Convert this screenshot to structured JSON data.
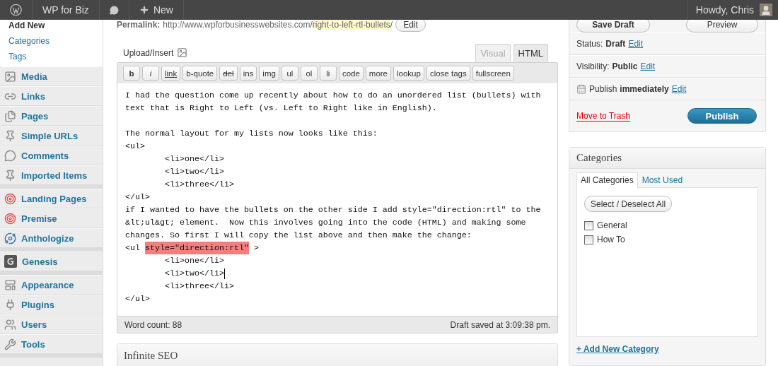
{
  "admin_bar": {
    "site_name": "WP for Biz",
    "new_label": "New",
    "greeting": "Howdy, Chris"
  },
  "sidebar": {
    "submenu": [
      {
        "label": "Add New",
        "current": true
      },
      {
        "label": "Categories",
        "current": false
      },
      {
        "label": "Tags",
        "current": false
      }
    ],
    "groups": [
      [
        {
          "label": "Media"
        },
        {
          "label": "Links"
        },
        {
          "label": "Pages"
        },
        {
          "label": "Simple URLs"
        },
        {
          "label": "Comments"
        },
        {
          "label": "Imported Items"
        }
      ],
      [
        {
          "label": "Landing Pages"
        },
        {
          "label": "Premise"
        },
        {
          "label": "Anthologize"
        }
      ],
      [
        {
          "label": "Genesis"
        }
      ],
      [
        {
          "label": "Appearance"
        },
        {
          "label": "Plugins"
        },
        {
          "label": "Users"
        },
        {
          "label": "Tools"
        }
      ]
    ]
  },
  "permalink": {
    "label": "Permalink:",
    "base": "http://www.wpforbusinesswebsites.com/",
    "slug": "right-to-left-rtl-bullets",
    "trailing": "/",
    "edit_button": "Edit"
  },
  "upload_insert": "Upload/Insert",
  "editor_tabs": [
    {
      "label": "Visual",
      "selected": false
    },
    {
      "label": "HTML",
      "selected": true
    }
  ],
  "quicktags": [
    {
      "label": "b",
      "kind": "bold"
    },
    {
      "label": "i",
      "kind": "italic"
    },
    {
      "label": "link",
      "kind": "underline"
    },
    {
      "label": "b-quote",
      "kind": "plain"
    },
    {
      "label": "del",
      "kind": "strike"
    },
    {
      "label": "ins",
      "kind": "plain"
    },
    {
      "label": "img",
      "kind": "plain"
    },
    {
      "label": "ul",
      "kind": "plain"
    },
    {
      "label": "ol",
      "kind": "plain"
    },
    {
      "label": "li",
      "kind": "plain"
    },
    {
      "label": "code",
      "kind": "plain"
    },
    {
      "label": "more",
      "kind": "plain"
    },
    {
      "label": "lookup",
      "kind": "plain"
    },
    {
      "label": "close tags",
      "kind": "plain"
    },
    {
      "label": "fullscreen",
      "kind": "plain"
    }
  ],
  "editor_lines": [
    {
      "kind": "text",
      "indented": false,
      "caret": false,
      "segments": [
        {
          "text": "I had the question come up recently about how to do an unordered list (bullets) with",
          "highlighted": false
        }
      ]
    },
    {
      "kind": "text",
      "indented": false,
      "caret": false,
      "segments": [
        {
          "text": "text that is Right to Left (vs. Left to Right like in English).",
          "highlighted": false
        }
      ]
    },
    {
      "kind": "blank"
    },
    {
      "kind": "text",
      "indented": false,
      "caret": false,
      "segments": [
        {
          "text": "The normal layout for my lists now looks like this:",
          "highlighted": false
        }
      ]
    },
    {
      "kind": "text",
      "indented": false,
      "caret": false,
      "segments": [
        {
          "text": "<ul>",
          "highlighted": false
        }
      ]
    },
    {
      "kind": "text",
      "indented": true,
      "caret": false,
      "segments": [
        {
          "text": "<li>one</li>",
          "highlighted": false
        }
      ]
    },
    {
      "kind": "text",
      "indented": true,
      "caret": false,
      "segments": [
        {
          "text": "<li>two</li>",
          "highlighted": false
        }
      ]
    },
    {
      "kind": "text",
      "indented": true,
      "caret": false,
      "segments": [
        {
          "text": "<li>three</li>",
          "highlighted": false
        }
      ]
    },
    {
      "kind": "text",
      "indented": false,
      "caret": false,
      "segments": [
        {
          "text": "</ul>",
          "highlighted": false
        }
      ]
    },
    {
      "kind": "text",
      "indented": false,
      "caret": false,
      "segments": [
        {
          "text": "if I wanted to have the bullets on the other side I add style=\"direction:rtl\" to the",
          "highlighted": false
        }
      ]
    },
    {
      "kind": "text",
      "indented": false,
      "caret": false,
      "segments": [
        {
          "text": "&lt;ul&gt; element.  Now this involves going into the code (HTML) and making some",
          "highlighted": false
        }
      ]
    },
    {
      "kind": "text",
      "indented": false,
      "caret": false,
      "segments": [
        {
          "text": "changes. So first I will copy the list above and then make the change:",
          "highlighted": false
        }
      ]
    },
    {
      "kind": "text",
      "indented": false,
      "caret": false,
      "segments": [
        {
          "text": "<ul ",
          "highlighted": false
        },
        {
          "text": "style=\"direction:rtl\"",
          "highlighted": true
        },
        {
          "text": " >",
          "highlighted": false
        }
      ]
    },
    {
      "kind": "text",
      "indented": true,
      "caret": false,
      "segments": [
        {
          "text": "<li>one</li>",
          "highlighted": false
        }
      ]
    },
    {
      "kind": "text",
      "indented": true,
      "caret": true,
      "segments": [
        {
          "text": "<li>two</li>",
          "highlighted": false
        }
      ]
    },
    {
      "kind": "text",
      "indented": true,
      "caret": false,
      "segments": [
        {
          "text": "<li>three</li>",
          "highlighted": false
        }
      ]
    },
    {
      "kind": "text",
      "indented": false,
      "caret": false,
      "segments": [
        {
          "text": "</ul>",
          "highlighted": false
        }
      ]
    }
  ],
  "editor_footer": {
    "word_count": "Word count: 88",
    "draft_saved": "Draft saved at 3:09:38 pm."
  },
  "next_box_title": "Infinite SEO",
  "publish_box": {
    "save_draft": "Save Draft",
    "preview": "Preview",
    "rows": [
      {
        "label": "Status:",
        "value": "Draft",
        "edit": "Edit",
        "icon": false
      },
      {
        "label": "Visibility:",
        "value": "Public",
        "edit": "Edit",
        "icon": false
      },
      {
        "label": "Publish",
        "value": "immediately",
        "edit": "Edit",
        "icon": true
      }
    ],
    "trash": "Move to Trash",
    "publish": "Publish"
  },
  "categories_box": {
    "title": "Categories",
    "tabs": [
      {
        "label": "All Categories",
        "selected": true
      },
      {
        "label": "Most Used",
        "selected": false
      }
    ],
    "select_all": "Select / Deselect All",
    "items": [
      {
        "label": "General",
        "checked": false
      },
      {
        "label": "How To",
        "checked": false
      }
    ],
    "add_new": "+ Add New Category"
  }
}
